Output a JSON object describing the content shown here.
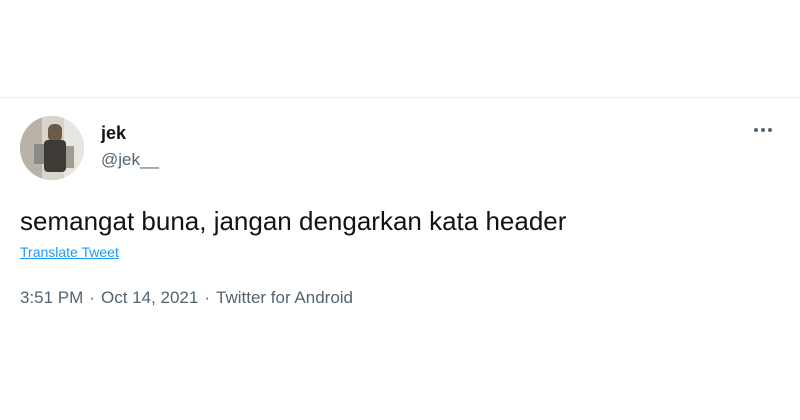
{
  "tweet": {
    "display_name": "jek",
    "handle": "@jek__",
    "text": "semangat buna, jangan dengarkan kata header",
    "translate_label": "Translate Tweet",
    "time": "3:51 PM",
    "date": "Oct 14, 2021",
    "source": "Twitter for Android",
    "separator": "·",
    "more_icon": "more-horizontal-icon",
    "colors": {
      "text": "#0f1419",
      "secondary": "#536471",
      "link": "#1d9bf0",
      "divider": "#ebeef0"
    }
  }
}
